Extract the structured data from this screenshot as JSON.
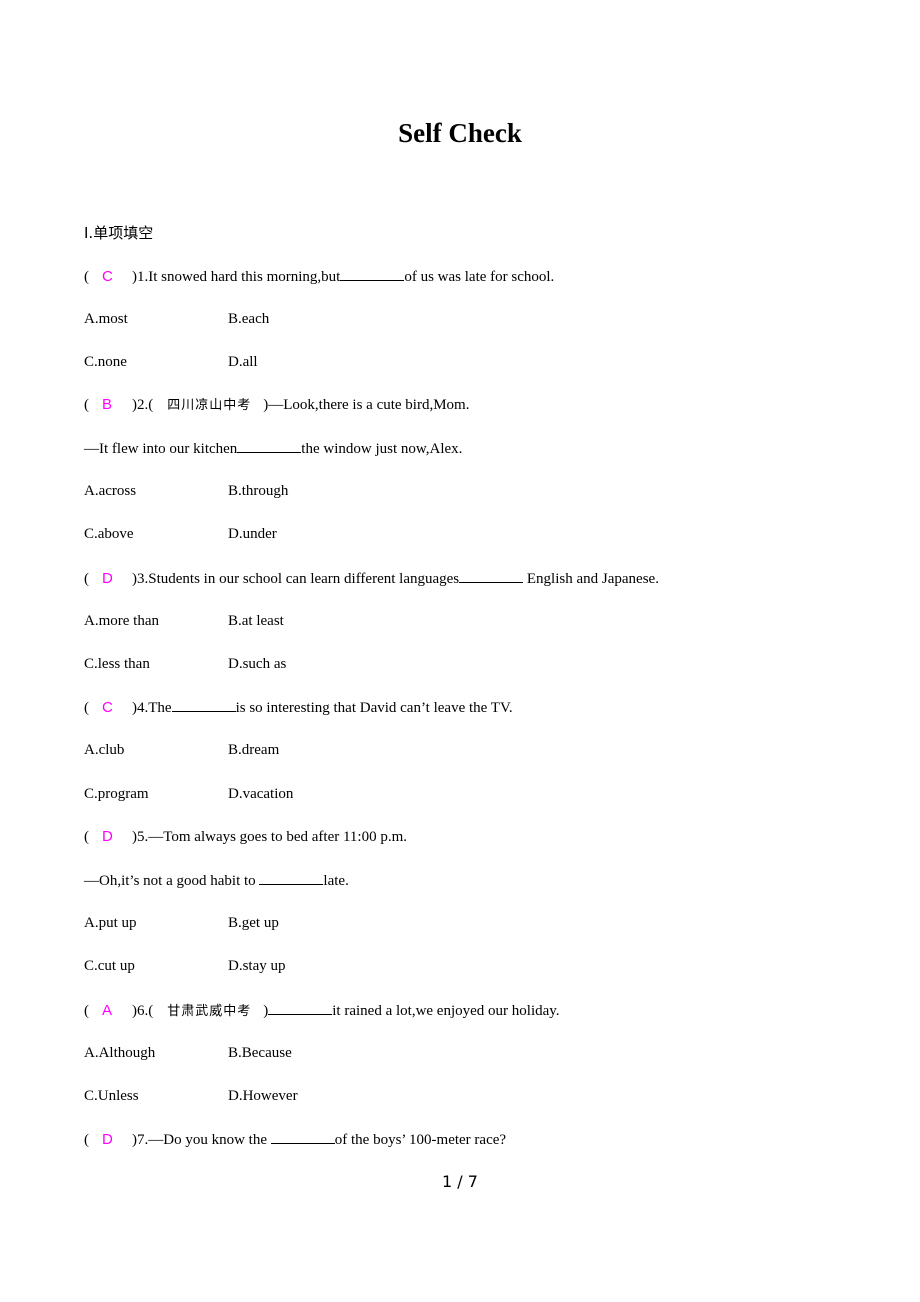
{
  "document": {
    "title": "Self Check",
    "section_heading": "Ⅰ.单项填空",
    "page_indicator": "1 / 7",
    "answer_color": "#ff00ff"
  },
  "questions": [
    {
      "number": "1",
      "answer": "C",
      "source": "",
      "stem_before": "It snowed hard this morning,but",
      "stem_after": "of us was late for school.",
      "second_line": null,
      "options": [
        "A.most",
        "B.each",
        "C.none",
        "D.all"
      ]
    },
    {
      "number": "2",
      "answer": "B",
      "source": "四川凉山中考",
      "stem_before": "—Look,there is a cute bird,Mom.",
      "stem_after": "",
      "second_line": {
        "before": "—It flew into our kitchen",
        "after": "the window just now,Alex."
      },
      "options": [
        "A.across",
        "B.through",
        "C.above",
        "D.under"
      ]
    },
    {
      "number": "3",
      "answer": "D",
      "source": "",
      "stem_before": "Students in our school can learn different languages",
      "stem_after": " English and Japanese.",
      "second_line": null,
      "options": [
        "A.more than",
        "B.at least",
        "C.less than",
        "D.such as"
      ]
    },
    {
      "number": "4",
      "answer": "C",
      "source": "",
      "stem_before": "The",
      "stem_after": "is so interesting that David can’t leave the TV.",
      "second_line": null,
      "options": [
        "A.club",
        "B.dream",
        "C.program",
        "D.vacation"
      ]
    },
    {
      "number": "5",
      "answer": "D",
      "source": "",
      "stem_before": "—Tom always goes to bed after 11:00 p.m.",
      "stem_after": "",
      "second_line": {
        "before": "—Oh,it’s not a good habit to ",
        "after": "late."
      },
      "options": [
        "A.put up",
        "B.get up",
        "C.cut up",
        "D.stay up"
      ]
    },
    {
      "number": "6",
      "answer": "A",
      "source": "甘肃武威中考",
      "stem_before": "",
      "stem_after": "it rained a lot,we enjoyed our holiday.",
      "second_line": null,
      "options": [
        "A.Although",
        "B.Because",
        "C.Unless",
        "D.However"
      ]
    },
    {
      "number": "7",
      "answer": "D",
      "source": "",
      "stem_before": "—Do you know the ",
      "stem_after": "of the boys’ 100-meter race?",
      "second_line": null,
      "options": []
    }
  ]
}
